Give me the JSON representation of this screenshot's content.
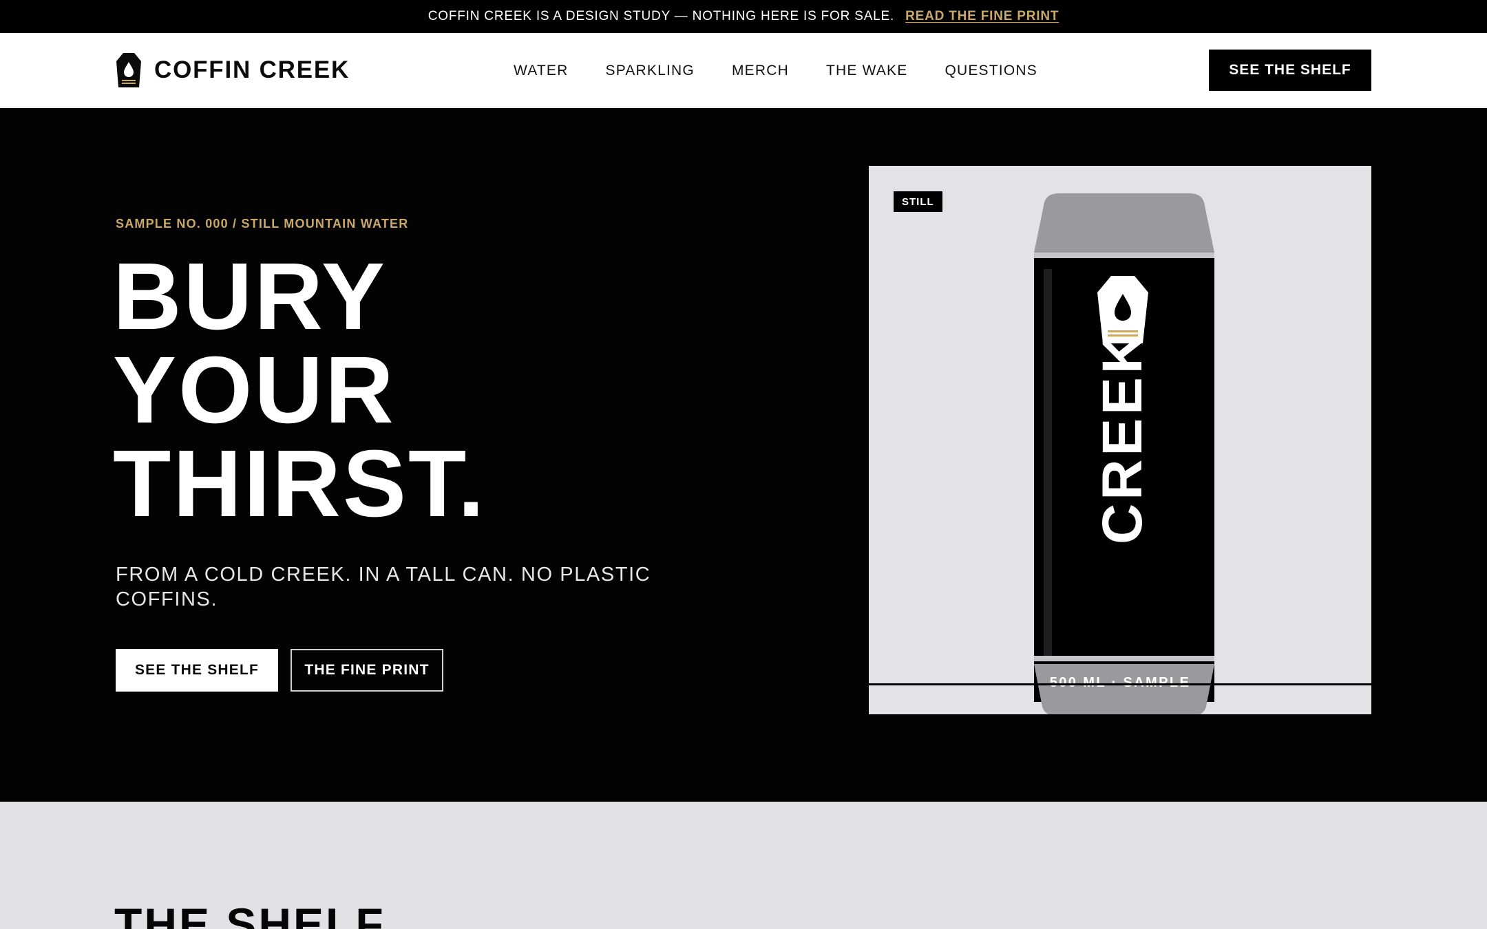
{
  "announcement": {
    "text": "COFFIN CREEK IS A DESIGN STUDY — NOTHING HERE IS FOR SALE.",
    "link": "READ THE FINE PRINT"
  },
  "header": {
    "brand": "COFFIN CREEK",
    "logo_icon": "coffin-drop-icon",
    "nav": [
      "WATER",
      "SPARKLING",
      "MERCH",
      "THE WAKE",
      "QUESTIONS"
    ],
    "cta": "SEE THE SHELF"
  },
  "hero": {
    "eyebrow": "SAMPLE NO. 000 / STILL MOUNTAIN WATER",
    "headline": [
      "BURY",
      "YOUR",
      "THIRST."
    ],
    "subhead": "FROM A COLD CREEK. IN A TALL CAN. NO PLASTIC COFFINS.",
    "primary_cta": "SEE THE SHELF",
    "secondary_cta": "THE FINE PRINT"
  },
  "product_card": {
    "badge": "STILL",
    "can_word": "CREEK",
    "can_size": "500 ML · SAMPLE",
    "can_icon": "coffin-drop-icon"
  },
  "shelf_section": {
    "title": "THE SHELF"
  },
  "colors": {
    "accent_gold": "#c9a96b",
    "black": "#000000",
    "card_bg": "#e3e2e5",
    "can_cap": "#9a999c"
  }
}
